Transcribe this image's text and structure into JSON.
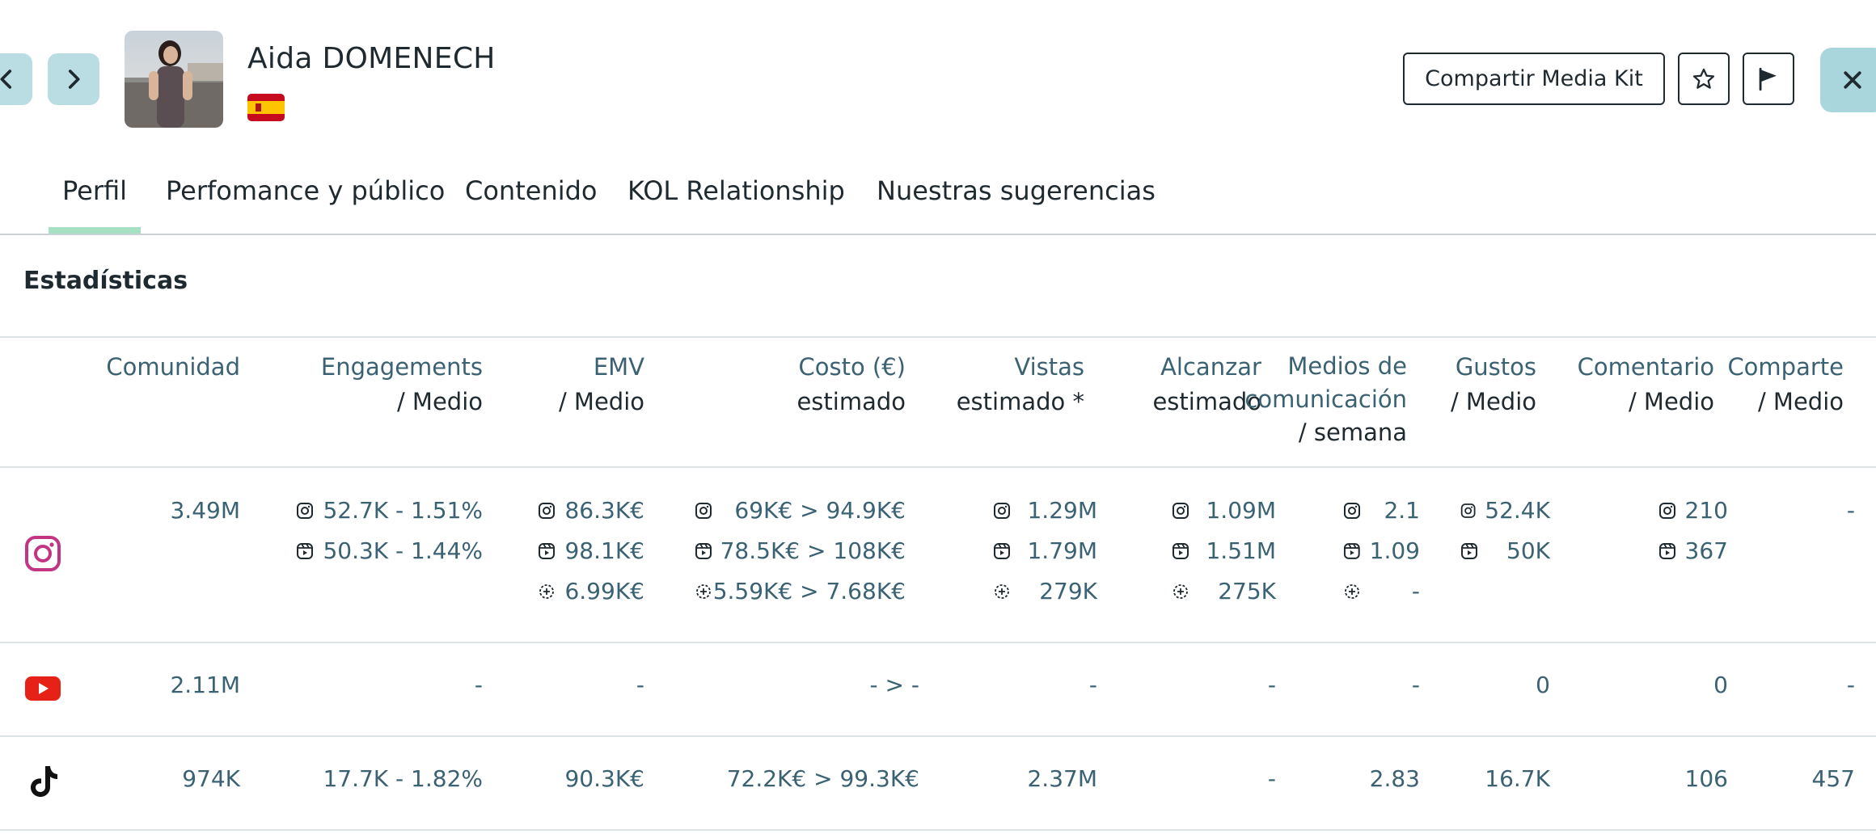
{
  "profile": {
    "name": "Aida DOMENECH",
    "country_flag": "spain-flag"
  },
  "header": {
    "share_label": "Compartir Media Kit",
    "favorite_icon": "star-icon",
    "report_icon": "flag-icon",
    "close_icon": "close-icon",
    "prev_icon": "chevron-left-icon",
    "next_icon": "chevron-right-icon"
  },
  "tabs": [
    {
      "label": "Perfil",
      "active": true
    },
    {
      "label": "Perfomance y público"
    },
    {
      "label": "Contenido"
    },
    {
      "label": "KOL Relationship"
    },
    {
      "label": "Nuestras sugerencias"
    }
  ],
  "section_title": "Estadísticas",
  "columns": [
    {
      "l1": "Comunidad",
      "l2": "",
      "l3": ""
    },
    {
      "l1": "Engagements",
      "l2": "/ Medio",
      "l3": ""
    },
    {
      "l1": "EMV",
      "l2": "/ Medio",
      "l3": ""
    },
    {
      "l1": "Costo (€)",
      "l2": "estimado",
      "l3": ""
    },
    {
      "l1": "Vistas",
      "l2": "estimado *",
      "l3": ""
    },
    {
      "l1": "Alcanzar",
      "l2": "estimado",
      "l3": ""
    },
    {
      "l1": "Medios de",
      "l2": "comunicación",
      "l3": "/ semana"
    },
    {
      "l1": "Gustos",
      "l2": "/ Medio",
      "l3": ""
    },
    {
      "l1": "Comentario",
      "l2": "/ Medio",
      "l3": ""
    },
    {
      "l1": "Comparte",
      "l2": "/ Medio",
      "l3": ""
    }
  ],
  "rows": {
    "instagram": {
      "icon": "instagram-icon",
      "community": "3.49M",
      "engagements": [
        "52.7K - 1.51%",
        "50.3K - 1.44%"
      ],
      "emv": [
        "86.3K€",
        "98.1K€",
        "6.99K€"
      ],
      "cost": [
        "69K€ > 94.9K€",
        "78.5K€ > 108K€",
        "5.59K€ > 7.68K€"
      ],
      "views": [
        "1.29M",
        "1.79M",
        "279K"
      ],
      "reach": [
        "1.09M",
        "1.51M",
        "275K"
      ],
      "media": [
        "2.1",
        "1.09",
        "-"
      ],
      "likes": [
        "52.4K",
        "50K"
      ],
      "comments": [
        "210",
        "367"
      ],
      "shares": "-"
    },
    "youtube": {
      "icon": "youtube-icon",
      "community": "2.11M",
      "engagements": "-",
      "emv": "-",
      "cost": "- > -",
      "views": "-",
      "reach": "-",
      "media": "-",
      "likes": "0",
      "comments": "0",
      "shares": "-"
    },
    "tiktok": {
      "icon": "tiktok-icon",
      "community": "974K",
      "engagements": "17.7K - 1.82%",
      "emv": "90.3K€",
      "cost": "72.2K€ > 99.3K€",
      "views": "2.37M",
      "reach": "-",
      "media": "2.83",
      "likes": "16.7K",
      "comments": "106",
      "shares": "457"
    }
  },
  "colors": {
    "accent": "#a8e0c4",
    "nav_button": "#b9dde3",
    "text_value": "#3b6273",
    "instagram": "#c13584",
    "youtube": "#e62117"
  }
}
